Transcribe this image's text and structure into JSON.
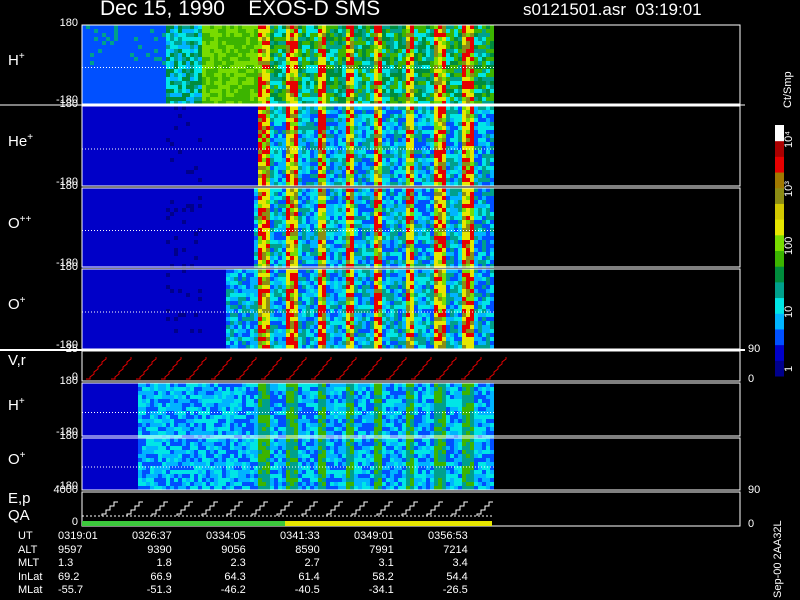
{
  "title": "Dec 15, 1990    EXOS-D SMS",
  "file_time": "s0121501.asr  03:19:01",
  "colorbar": {
    "unit": "Ct/Smp",
    "ticks": [
      "1",
      "10",
      "100",
      "10³",
      "10⁴"
    ],
    "colors": [
      "#00008b",
      "#0000c8",
      "#0050ff",
      "#00b4ff",
      "#00e6e6",
      "#00a08c",
      "#008c3c",
      "#3cb400",
      "#78dc00",
      "#e6e600",
      "#d2c800",
      "#8c8c14",
      "#a07800",
      "#e60000",
      "#aa0000",
      "#ffffff"
    ]
  },
  "panels": [
    {
      "label_base": "H",
      "label_sup": "+",
      "ytop": "180",
      "ybot": "-180"
    },
    {
      "label_base": "He",
      "label_sup": "+",
      "ytop": "180",
      "ybot": "-180"
    },
    {
      "label_base": "O",
      "label_sup": "++",
      "ytop": "180",
      "ybot": "-180"
    },
    {
      "label_base": "O",
      "label_sup": "+",
      "ytop": "180",
      "ybot": "-180"
    },
    {
      "label_base": "V,r",
      "label_sup": "",
      "ytop": "25",
      "ybot": "0",
      "rtop": "90",
      "rbot": "0"
    },
    {
      "label_base": "H",
      "label_sup": "+",
      "ytop": "180",
      "ybot": "-180"
    },
    {
      "label_base": "O",
      "label_sup": "+",
      "ytop": "180",
      "ybot": "-180"
    },
    {
      "label_base": "E,p",
      "label_sup": "",
      "label2": "QA",
      "ytop": "4000",
      "ybot": "0",
      "rtop": "90",
      "rbot": "0"
    }
  ],
  "ephemeris": {
    "rows": [
      {
        "key": "UT",
        "values": [
          "0319:01",
          "0326:37",
          "0334:05",
          "0341:33",
          "0349:01",
          "0356:53"
        ]
      },
      {
        "key": "ALT",
        "values": [
          "9597",
          "9390",
          "9056",
          "8590",
          "7991",
          "7214"
        ]
      },
      {
        "key": "MLT",
        "values": [
          "1.3",
          "1.8",
          "2.3",
          "2.7",
          "3.1",
          "3.4"
        ]
      },
      {
        "key": "InLat",
        "values": [
          "69.2",
          "66.9",
          "64.3",
          "61.4",
          "58.2",
          "54.4"
        ]
      },
      {
        "key": "MLat",
        "values": [
          "-55.7",
          "-51.3",
          "-46.2",
          "-40.5",
          "-34.1",
          "-26.5"
        ]
      }
    ]
  },
  "footer": "Sep-00  2AA32L",
  "chart_data": {
    "type": "heatmap",
    "title": "Dec 15, 1990    EXOS-D SMS",
    "x": [
      "0319:01",
      "0326:37",
      "0334:05",
      "0341:33",
      "0349:01",
      "0356:53"
    ],
    "series": [
      {
        "name": "H+",
        "ylim": [
          -180,
          180
        ]
      },
      {
        "name": "He+",
        "ylim": [
          -180,
          180
        ]
      },
      {
        "name": "O++",
        "ylim": [
          -180,
          180
        ]
      },
      {
        "name": "O+",
        "ylim": [
          -180,
          180
        ]
      },
      {
        "name": "V,r",
        "ylim": [
          0,
          25
        ]
      },
      {
        "name": "H+",
        "ylim": [
          -180,
          180
        ]
      },
      {
        "name": "O+",
        "ylim": [
          -180,
          180
        ]
      },
      {
        "name": "E,p",
        "ylim": [
          0,
          4000
        ]
      }
    ],
    "colorbar_range": [
      1,
      10000
    ],
    "colorbar_scale": "log"
  }
}
